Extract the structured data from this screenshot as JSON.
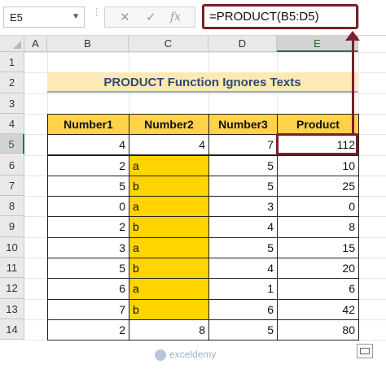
{
  "formula_bar": {
    "name_box": "E5",
    "cancel_glyph": "✕",
    "enter_glyph": "✓",
    "fx_label": "fx",
    "formula": "=PRODUCT(B5:D5)"
  },
  "columns": [
    "A",
    "B",
    "C",
    "D",
    "E"
  ],
  "selected_column": "E",
  "rows": [
    "1",
    "2",
    "3",
    "4",
    "5",
    "6",
    "7",
    "8",
    "9",
    "10",
    "11",
    "12",
    "13",
    "14"
  ],
  "selected_row": "5",
  "title": "PRODUCT Function Ignores Texts",
  "table": {
    "headers": [
      "Number1",
      "Number2",
      "Number3",
      "Product"
    ],
    "rows": [
      {
        "b": "4",
        "c": "4",
        "d": "7",
        "e": "112"
      },
      {
        "b": "2",
        "c": "a",
        "d": "5",
        "e": "10"
      },
      {
        "b": "5",
        "c": "b",
        "d": "5",
        "e": "25"
      },
      {
        "b": "0",
        "c": "a",
        "d": "3",
        "e": "0"
      },
      {
        "b": "2",
        "c": "b",
        "d": "4",
        "e": "8"
      },
      {
        "b": "3",
        "c": "a",
        "d": "5",
        "e": "15"
      },
      {
        "b": "5",
        "c": "b",
        "d": "4",
        "e": "20"
      },
      {
        "b": "6",
        "c": "a",
        "d": "1",
        "e": "6"
      },
      {
        "b": "7",
        "c": "b",
        "d": "6",
        "e": "42"
      },
      {
        "b": "2",
        "c": "8",
        "d": "5",
        "e": "80"
      }
    ]
  },
  "watermark": "exceldemy",
  "colors": {
    "header_fill": "#ffd24a",
    "text_fill": "#ffd400",
    "highlight": "#7a1f2b",
    "title_fill": "#fde9b6"
  }
}
